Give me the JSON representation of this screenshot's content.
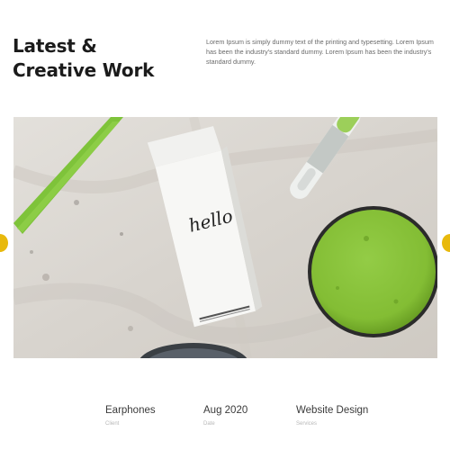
{
  "section": {
    "heading_line1": "Latest &",
    "heading_line2": "Creative Work",
    "intro": "Lorem Ipsum is simply dummy text of the printing and typesetting. Lorem Ipsum has been the industry's standard dummy. Lorem Ipsum has been the industry's standard dummy."
  },
  "slider": {
    "carton_text": "hello",
    "accent_color": "#e8b90c",
    "paint_color": "#8cc63f",
    "prev_icon": "chevron-left-icon",
    "next_icon": "chevron-right-icon"
  },
  "project": {
    "client": {
      "value": "Earphones",
      "label": "Client"
    },
    "date": {
      "value": "Aug 2020",
      "label": "Date"
    },
    "services": {
      "value": "Website Design",
      "label": "Services"
    }
  }
}
